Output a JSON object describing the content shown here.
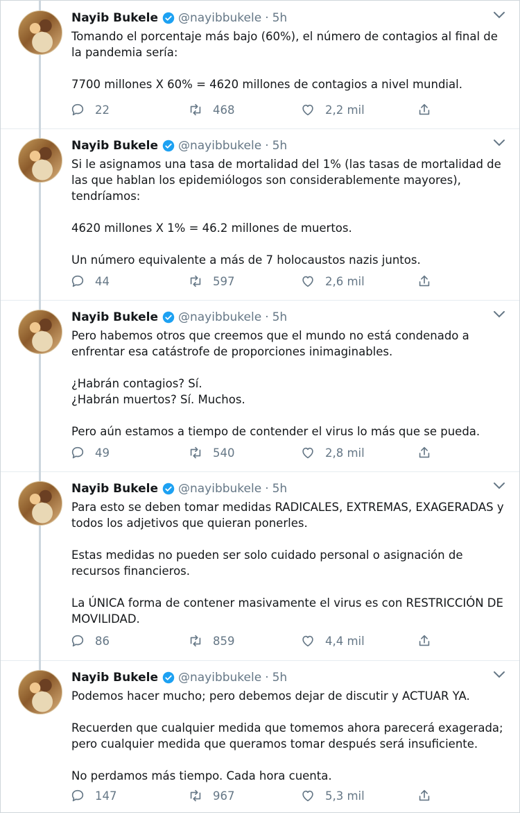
{
  "author": {
    "name": "Nayib Bukele",
    "handle": "@nayibbukele",
    "separator": "·",
    "time": "5h"
  },
  "icons": {
    "verified": "verified-badge-icon",
    "menu": "chevron-down-icon",
    "reply": "reply-icon",
    "retweet": "retweet-icon",
    "like": "heart-icon",
    "share": "share-icon"
  },
  "colors": {
    "accent": "#1da1f2",
    "muted": "#657786",
    "text": "#14171a"
  },
  "tweets": [
    {
      "paragraphs": [
        "Tomando el porcentaje más bajo (60%), el número de contagios al final de la pandemia sería:",
        "7700 millones X 60% = 4620 millones de contagios a nivel mundial."
      ],
      "replies": "22",
      "retweets": "468",
      "likes": "2,2 mil"
    },
    {
      "paragraphs": [
        "Si le asignamos una tasa de mortalidad del 1% (las tasas de mortalidad de las que hablan los epidemiólogos son considerablemente mayores), tendríamos:",
        "4620 millones X 1% = 46.2 millones de muertos.",
        "Un número equivalente a más de 7 holocaustos nazis juntos."
      ],
      "replies": "44",
      "retweets": "597",
      "likes": "2,6 mil"
    },
    {
      "paragraphs": [
        "Pero habemos otros que creemos que el mundo no está condenado a enfrentar esa catástrofe de proporciones inimaginables.",
        "¿Habrán contagios? Sí.\n¿Habrán muertos? Sí. Muchos.",
        "Pero aún estamos a tiempo de contender el virus lo más que se pueda."
      ],
      "replies": "49",
      "retweets": "540",
      "likes": "2,8 mil"
    },
    {
      "paragraphs": [
        "Para esto se deben tomar medidas RADICALES, EXTREMAS, EXAGERADAS y todos los adjetivos que quieran ponerles.",
        "Estas medidas no pueden ser solo cuidado personal o asignación de recursos financieros.",
        "La ÚNICA forma de contener masivamente el virus es con RESTRICCIÓN DE MOVILIDAD."
      ],
      "replies": "86",
      "retweets": "859",
      "likes": "4,4 mil"
    },
    {
      "paragraphs": [
        "Podemos hacer mucho; pero debemos dejar de discutir y ACTUAR YA.",
        "Recuerden que cualquier medida que tomemos ahora parecerá exagerada; pero cualquier medida que queramos tomar después será insuficiente.",
        "No perdamos más tiempo. Cada hora cuenta."
      ],
      "replies": "147",
      "retweets": "967",
      "likes": "5,3 mil"
    }
  ]
}
